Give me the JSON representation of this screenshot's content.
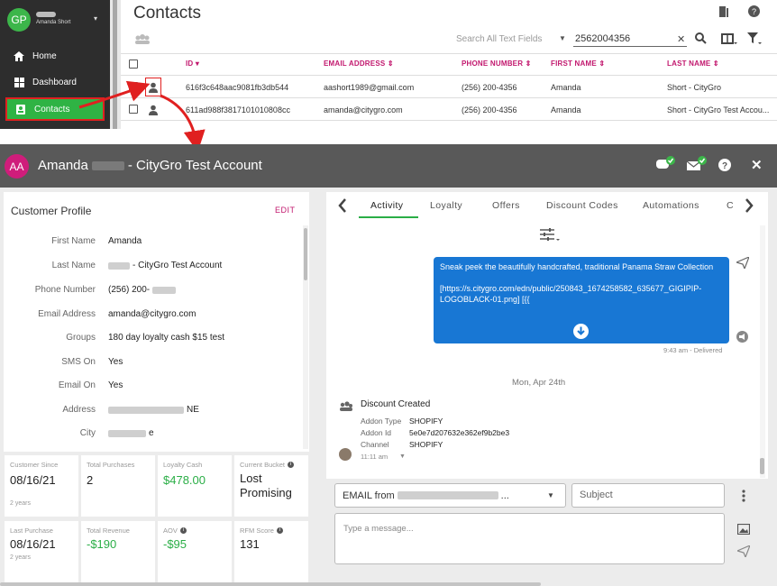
{
  "sidebar": {
    "avatar_initials": "GP",
    "user_name": "Amanda Short",
    "items": [
      {
        "label": "Home",
        "icon": "home-icon"
      },
      {
        "label": "Dashboard",
        "icon": "dashboard-icon"
      },
      {
        "label": "Contacts",
        "icon": "contacts-icon"
      }
    ]
  },
  "contacts": {
    "title": "Contacts",
    "search_placeholder": "Search All Text Fields",
    "search_value": "2562004356",
    "columns": [
      "ID",
      "EMAIL ADDRESS",
      "PHONE NUMBER",
      "FIRST NAME",
      "LAST NAME"
    ],
    "rows": [
      {
        "id": "616f3c648aac9081fb3db544",
        "email": "aashort1989@gmail.com",
        "phone": "(256) 200-4356",
        "first": "Amanda",
        "last": "Short - CityGro"
      },
      {
        "id": "611ad988f3817101010808cc",
        "email": "amanda@citygro.com",
        "phone": "(256) 200-4356",
        "first": "Amanda",
        "last": "Short - CityGro Test Accou..."
      }
    ]
  },
  "modal": {
    "avatar_initials": "AA",
    "title_first": "Amanda",
    "title_rest": "- CityGro Test Account",
    "close_label": "✕",
    "help_label": "?"
  },
  "profile": {
    "title": "Customer Profile",
    "edit_label": "EDIT",
    "fields": [
      {
        "label": "First Name",
        "value": "Amanda"
      },
      {
        "label": "Last Name",
        "value": "- CityGro Test Account"
      },
      {
        "label": "Phone Number",
        "value": "(256) 200-"
      },
      {
        "label": "Email Address",
        "value": "amanda@citygro.com"
      },
      {
        "label": "Groups",
        "value": "180 day loyalty cash $15 test"
      },
      {
        "label": "SMS On",
        "value": "Yes"
      },
      {
        "label": "Email On",
        "value": "Yes"
      },
      {
        "label": "Address",
        "value": "NE"
      },
      {
        "label": "City",
        "value": "e"
      }
    ],
    "stats": [
      {
        "label": "Customer Since",
        "value": "08/16/21",
        "sub": "2 years"
      },
      {
        "label": "Total Purchases",
        "value": "2",
        "sub": ""
      },
      {
        "label": "Loyalty Cash",
        "value": "$478.00",
        "sub": ""
      },
      {
        "label": "Current Bucket",
        "value": "Lost Promising",
        "sub": ""
      },
      {
        "label": "Last Purchase",
        "value": "08/16/21",
        "sub": "2 years"
      },
      {
        "label": "Total Revenue",
        "value": "-$190",
        "sub": ""
      },
      {
        "label": "AOV",
        "value": "-$95",
        "sub": ""
      },
      {
        "label": "RFM Score",
        "value": "131",
        "sub": ""
      }
    ]
  },
  "activity": {
    "tabs": [
      "Activity",
      "Loyalty",
      "Offers",
      "Discount Codes",
      "Automations",
      "C"
    ],
    "message_line1": "Sneak peek the beautifully handcrafted, traditional Panama Straw Collection",
    "message_line2": "[https://s.citygro.com/edn/public/250843_1674258582_635677_GIGIPIP-LOGOBLACK-01.png] [{{",
    "message_meta": "9:43 am - Delivered",
    "date_divider": "Mon, Apr 24th",
    "event_title": "Discount Created",
    "event_fields": [
      {
        "label": "Addon Type",
        "value": "SHOPIFY"
      },
      {
        "label": "Addon Id",
        "value": "5e0e7d207632e362ef9b2be3"
      },
      {
        "label": "Channel",
        "value": "SHOPIFY"
      }
    ],
    "event_time": "11:11 am"
  },
  "compose": {
    "email_from": "EMAIL from",
    "email_from_suffix": "...",
    "subject_placeholder": "Subject",
    "message_placeholder": "Type a message..."
  },
  "colors": {
    "accent": "#c2186e",
    "green": "#2aae46",
    "blue": "#1877d4",
    "header": "#595959"
  }
}
